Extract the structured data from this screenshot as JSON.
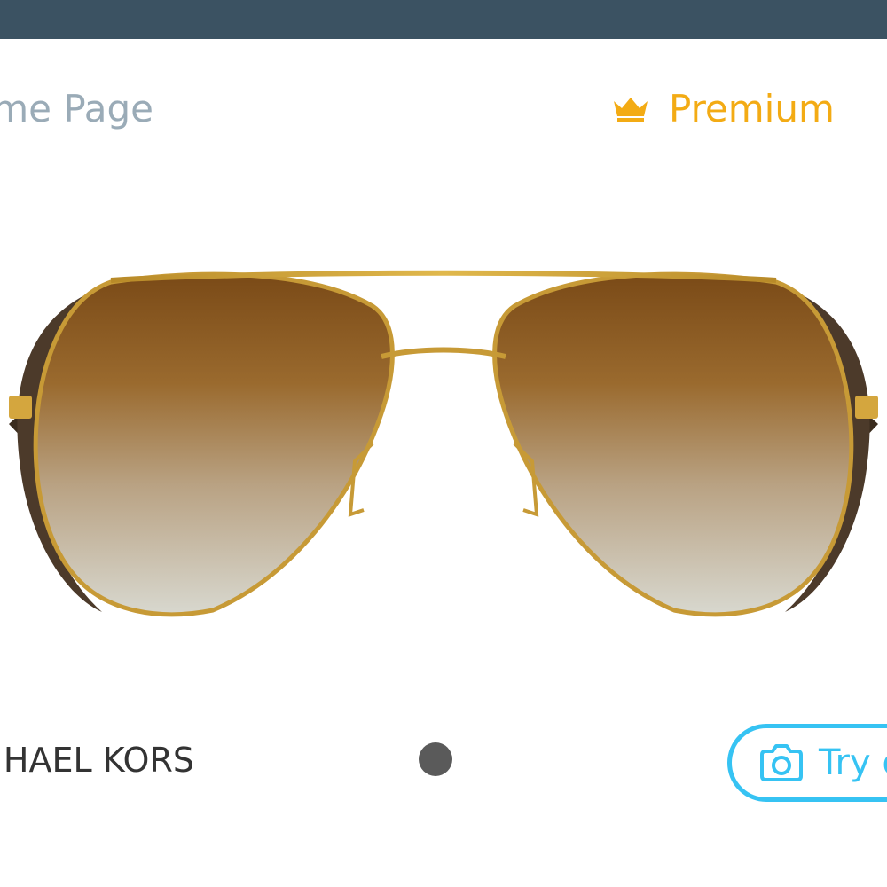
{
  "header": {
    "bar_color": "#3b5262"
  },
  "nav": {
    "home_label": "me Page",
    "premium_label": "Premium",
    "premium_icon": "crown-icon",
    "premium_color": "#f3ab14"
  },
  "product": {
    "image": "aviator-sunglasses-gold-frame-gradient-brown-lenses",
    "brand": "HAEL KORS"
  },
  "carousel": {
    "pages_visible": 1,
    "active_dot_color": "#5a5a5a"
  },
  "try_button": {
    "label": "Try o",
    "icon": "camera-icon",
    "accent_color": "#36c3f3"
  }
}
